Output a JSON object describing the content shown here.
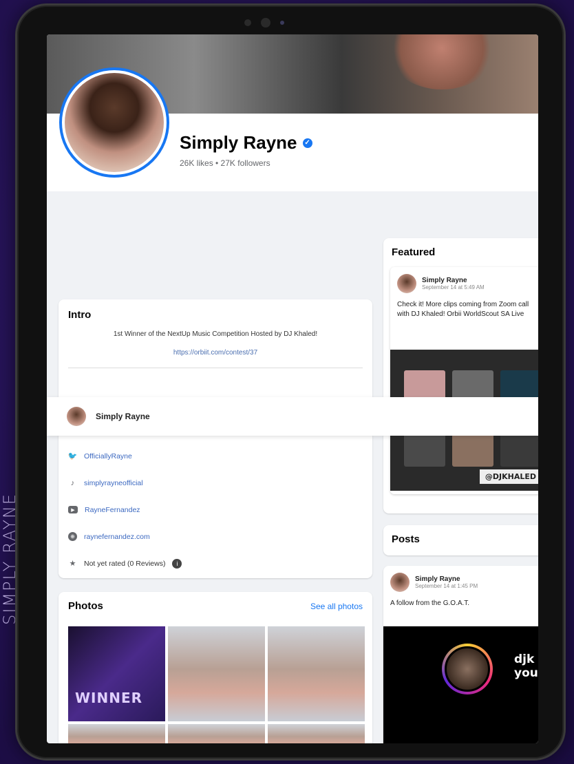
{
  "side_label": "SIMPLY RAYNE",
  "profile": {
    "name": "Simply Rayne",
    "stats": "26K likes • 27K followers"
  },
  "intro": {
    "title": "Intro",
    "bio": "1st Winner of the NextUp Music Competition Hosted by DJ Khaled!",
    "link": "https://orbiit.com/contest/37",
    "items": [
      {
        "icon": "twitter-icon",
        "label": "OfficiallyRayne"
      },
      {
        "icon": "tiktok-icon",
        "label": "simplyrayneofficial"
      },
      {
        "icon": "youtube-icon",
        "label": "RayneFernandez"
      },
      {
        "icon": "globe-icon",
        "label": "raynefernandez.com"
      },
      {
        "icon": "star-icon",
        "label": "Not yet rated (0 Reviews)"
      }
    ]
  },
  "sticky_bar": {
    "name": "Simply Rayne"
  },
  "photos": {
    "title": "Photos",
    "see_all": "See all photos",
    "winner_text": "WINNER"
  },
  "featured": {
    "title": "Featured",
    "post": {
      "author": "Simply Rayne",
      "time": "September 14 at 5:49 AM",
      "text": "Check it! More clips coming from Zoom call with DJ Khaled! Orbii WorldScout SA Live",
      "tag": "@DJKHALED"
    }
  },
  "posts": {
    "title": "Posts",
    "post": {
      "author": "Simply Rayne",
      "time": "September 14 at 1:45 PM",
      "text": "A follow from the G.O.A.T.",
      "ig_name_line1": "djk",
      "ig_name_line2": "you"
    }
  }
}
